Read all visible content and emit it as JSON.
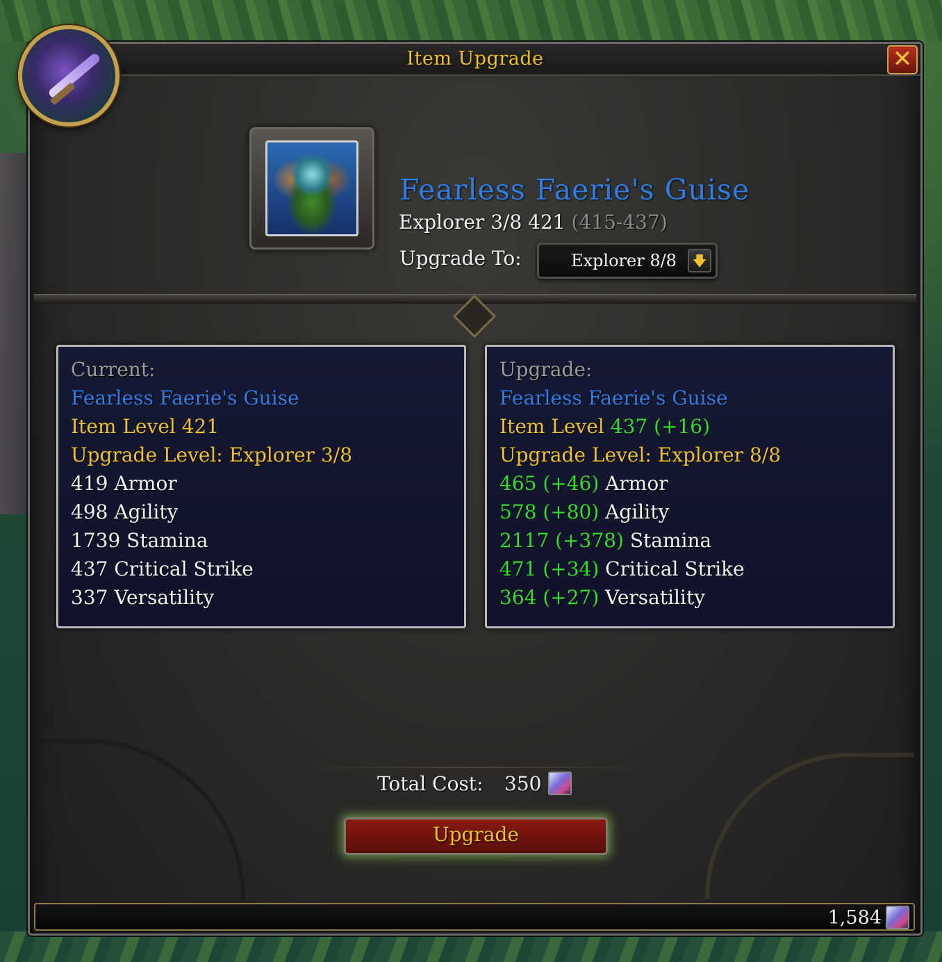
{
  "window": {
    "title": "Item Upgrade",
    "close_icon": "close-icon",
    "close_glyph": "✕"
  },
  "item": {
    "icon": "faerie-helm-icon",
    "name": "Fearless Faerie's Guise",
    "track": "Explorer 3/8  421 ",
    "range": "(415-437)",
    "upgrade_to_label": "Upgrade To:",
    "upgrade_to_value": "Explorer 8/8",
    "dropdown_arrow": "🡇"
  },
  "current": {
    "heading": "Current:",
    "name": "Fearless Faerie's Guise",
    "item_level": "Item Level 421",
    "upgrade_level": "Upgrade Level: Explorer 3/8",
    "stats": [
      "419 Armor",
      "498 Agility",
      "1739 Stamina",
      "437 Critical Strike",
      "337 Versatility"
    ]
  },
  "upgrade": {
    "heading": "Upgrade:",
    "name": "Fearless Faerie's Guise",
    "item_level_prefix": "Item Level ",
    "item_level_value": "437 (+16)",
    "upgrade_level": "Upgrade Level: Explorer 8/8",
    "stats": [
      {
        "value": "465 (+46)",
        "label": " Armor"
      },
      {
        "value": "578 (+80)",
        "label": " Agility"
      },
      {
        "value": "2117 (+378)",
        "label": " Stamina"
      },
      {
        "value": "471 (+34)",
        "label": " Critical Strike"
      },
      {
        "value": "364 (+27)",
        "label": " Versatility"
      }
    ]
  },
  "cost": {
    "label": "Total Cost:",
    "value": "350",
    "currency_icon": "crest-icon"
  },
  "upgrade_button": "Upgrade",
  "currency_bar": {
    "amount": "1,584",
    "currency_icon": "crest-icon"
  },
  "colors": {
    "title_gold": "#f0c22a",
    "item_blue": "#2e7ee6",
    "stat_green": "#2fe02f",
    "panel_bg": "#161933"
  }
}
